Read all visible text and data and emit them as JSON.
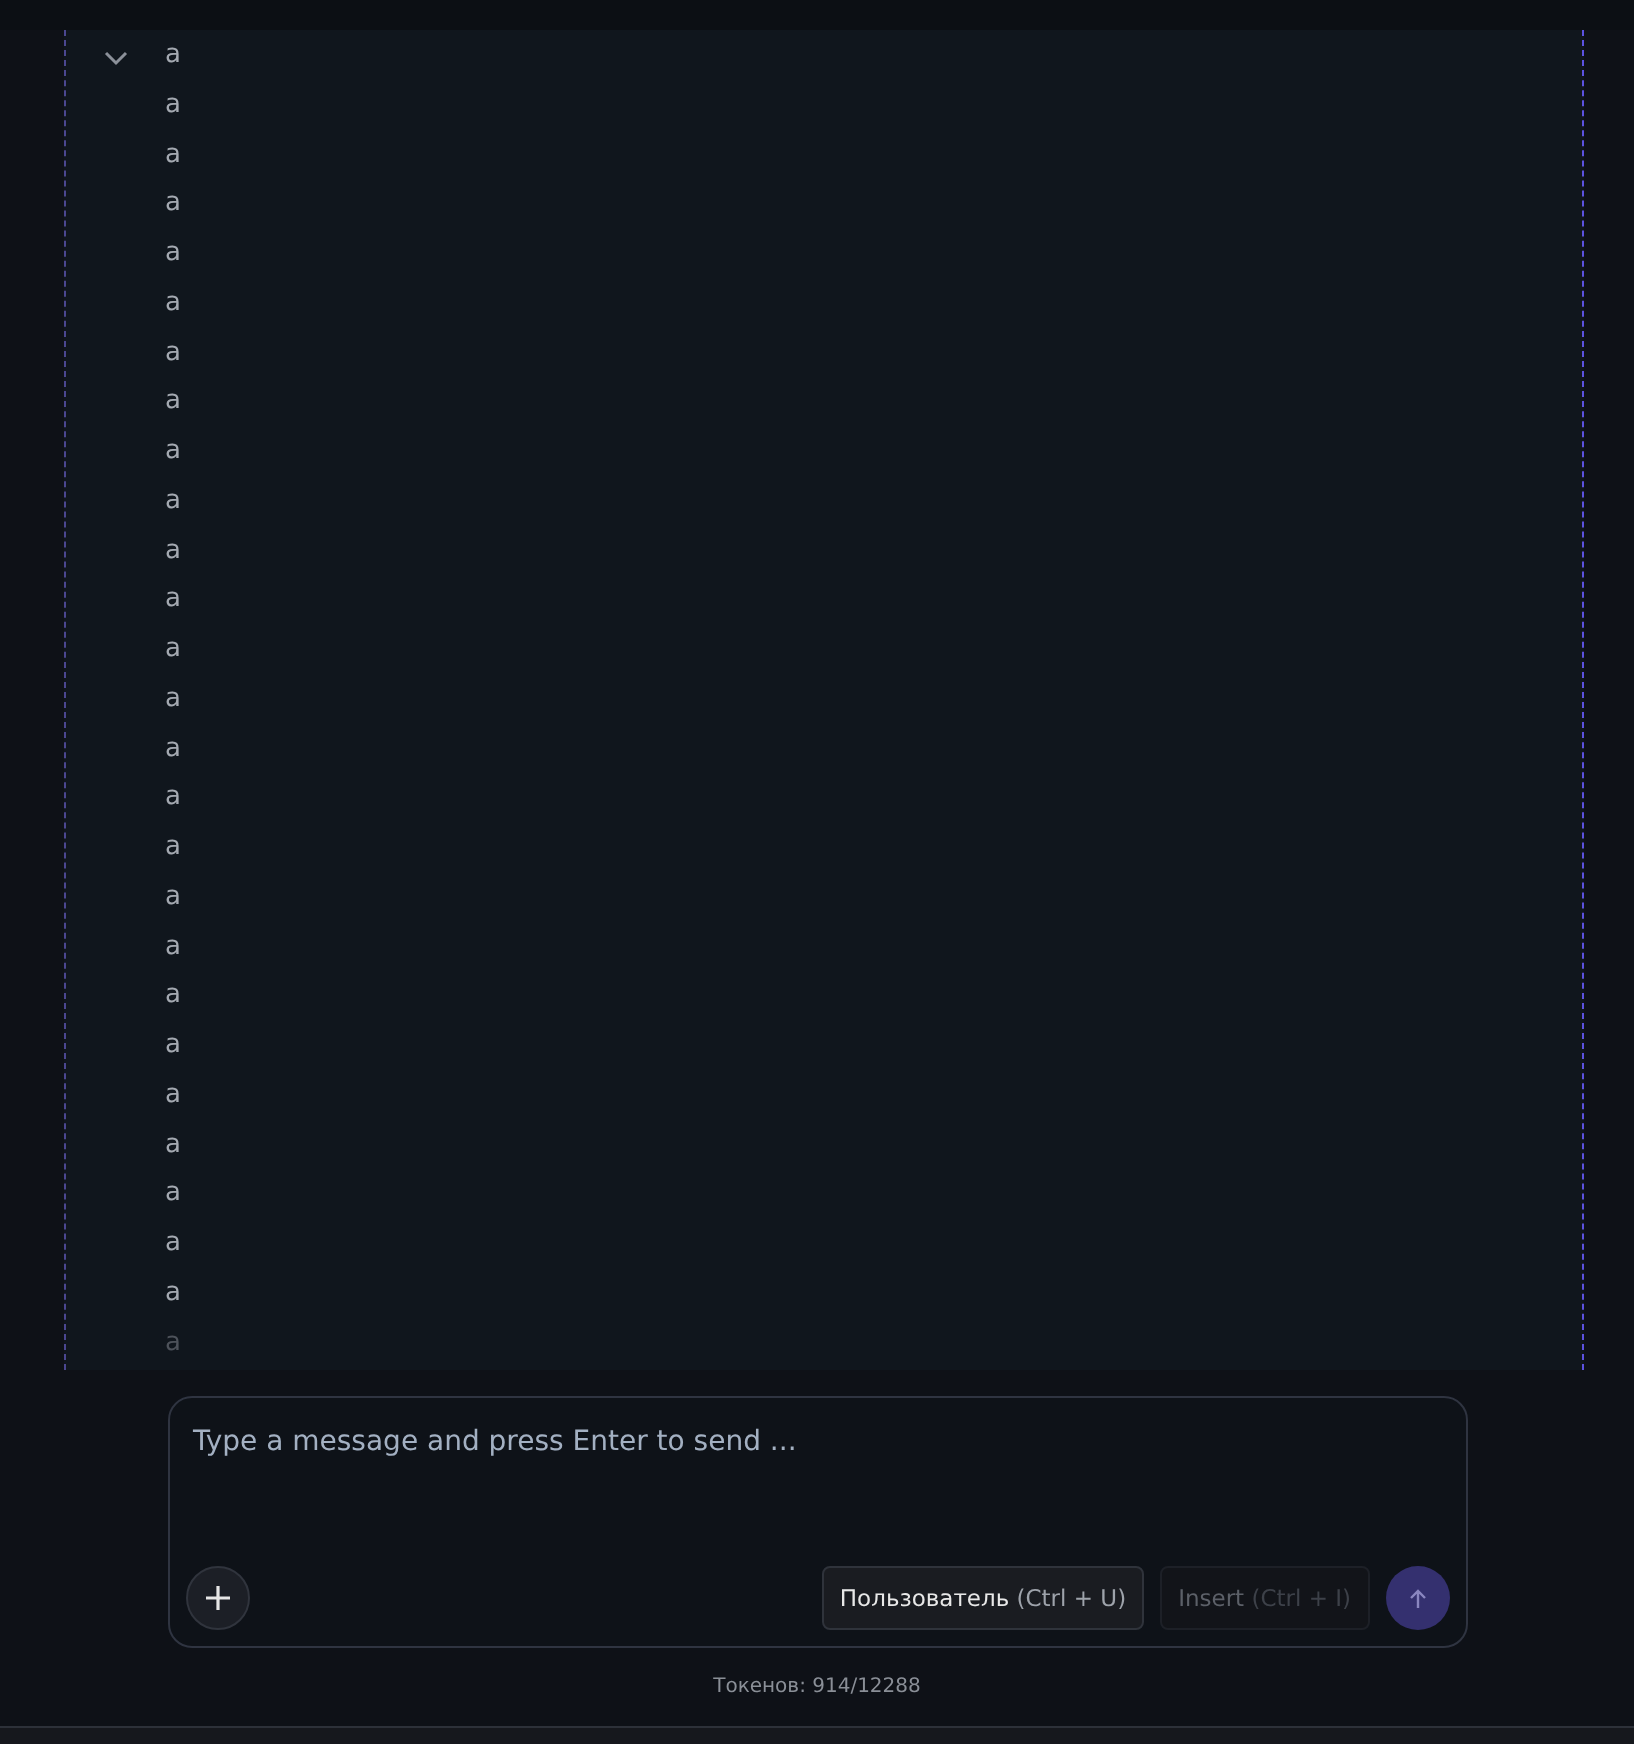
{
  "message": {
    "expanded": true,
    "lines": [
      "a",
      "a",
      "a",
      "a",
      "a",
      "a",
      "a",
      "a",
      "a",
      "a",
      "a",
      "a",
      "a",
      "a",
      "a",
      "a",
      "a",
      "a",
      "a",
      "a",
      "a",
      "a",
      "a",
      "a",
      "a",
      "a",
      "a"
    ]
  },
  "composer": {
    "placeholder": "Type a message and press Enter to send ...",
    "buttons": [
      {
        "kind": "role",
        "label": "Пользователь",
        "shortcut": "(Ctrl + U)",
        "disabled": false
      },
      {
        "kind": "role",
        "label": "Insert",
        "shortcut": "(Ctrl + I)",
        "disabled": true
      },
      {
        "kind": "send",
        "disabled": true
      }
    ]
  },
  "tokens": "Токенов: 914/12288"
}
